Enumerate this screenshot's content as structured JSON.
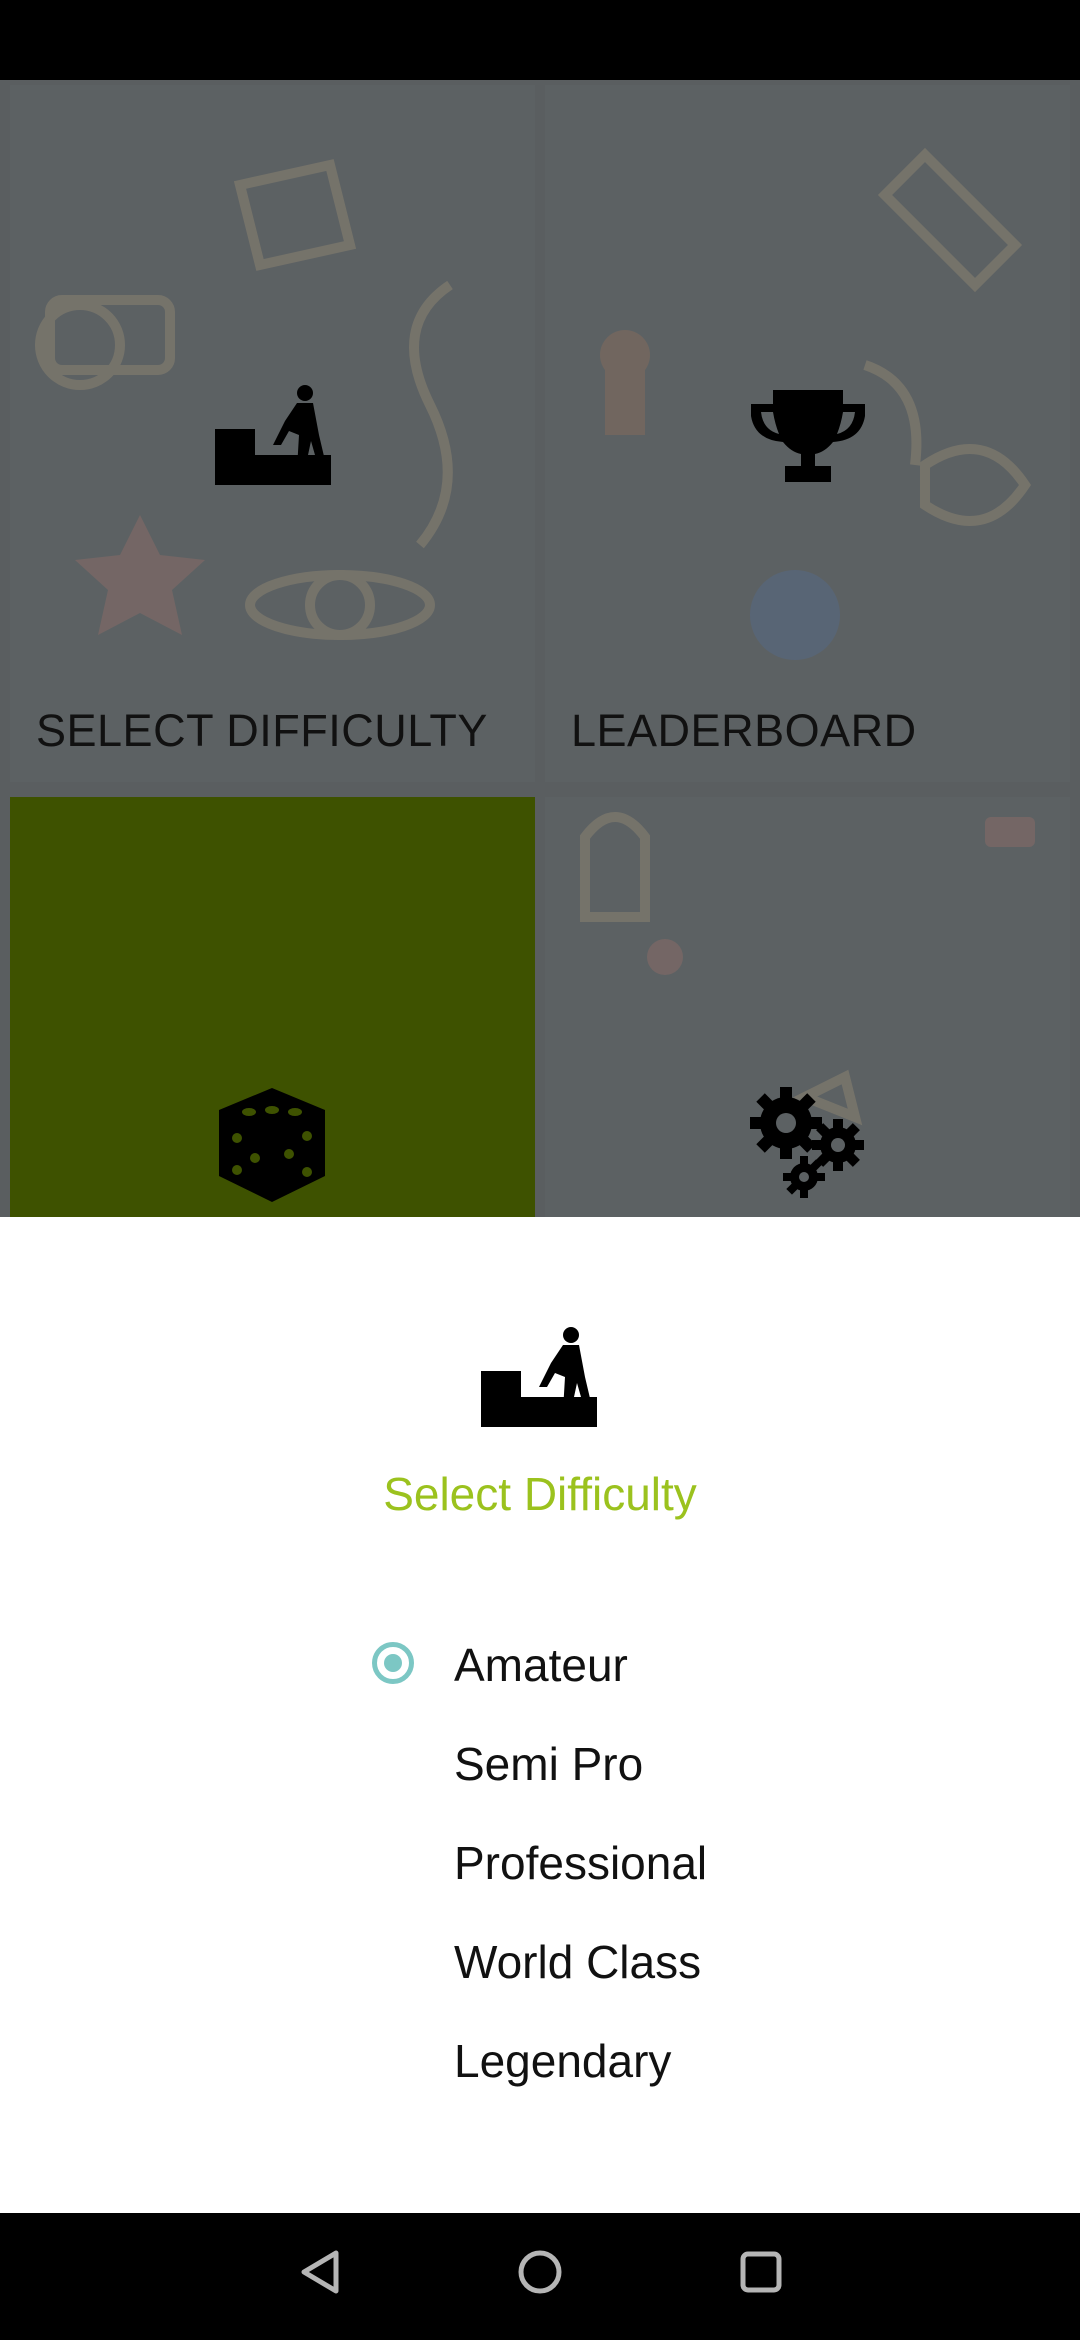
{
  "menu": {
    "tiles": [
      {
        "label": "SELECT DIFFICULTY",
        "icon": "stairs-climber-icon"
      },
      {
        "label": "LEADERBOARD",
        "icon": "trophy-icon"
      },
      {
        "label": "",
        "icon": "dice-icon"
      },
      {
        "label": "",
        "icon": "gears-icon"
      }
    ],
    "selected_tile_color": "#3e5200"
  },
  "dialog": {
    "icon": "stairs-climber-icon",
    "title": "Select Difficulty",
    "title_color": "#9bc21e",
    "selected_index": 0,
    "options": [
      "Amateur",
      "Semi Pro",
      "Professional",
      "World Class",
      "Legendary"
    ],
    "radio_color": "#7cc7c4"
  },
  "nav": {
    "back_icon": "back-triangle-icon",
    "home_icon": "home-circle-icon",
    "recents_icon": "recents-square-icon"
  }
}
